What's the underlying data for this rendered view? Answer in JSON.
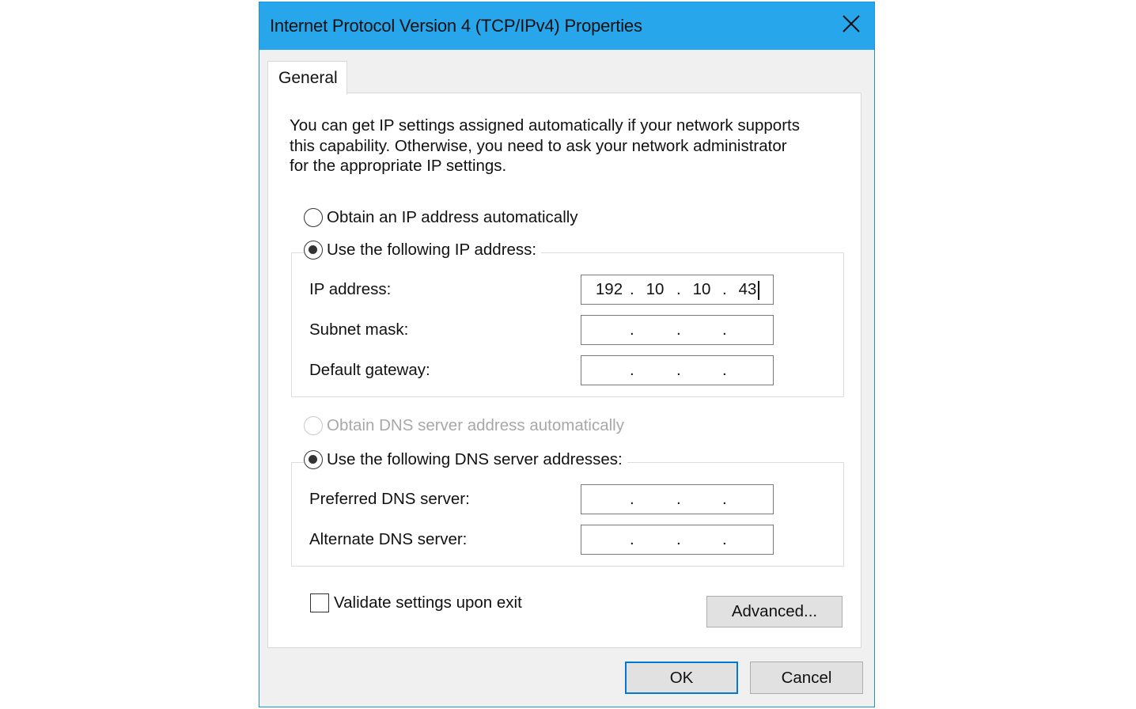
{
  "window": {
    "title": "Internet Protocol Version 4 (TCP/IPv4) Properties"
  },
  "tabs": [
    {
      "label": "General",
      "active": true
    }
  ],
  "description_lines": [
    "You can get IP settings assigned automatically if your network supports",
    "this capability. Otherwise, you need to ask your network administrator",
    "for the appropriate IP settings."
  ],
  "ip_mode": {
    "auto_label": "Obtain an IP address automatically",
    "manual_label": "Use the following IP address:",
    "selected": "manual"
  },
  "ip_fields": {
    "ip_address": {
      "label": "IP address:",
      "octets": [
        "192",
        "10",
        "10",
        "43"
      ]
    },
    "subnet_mask": {
      "label": "Subnet mask:",
      "octets": [
        "",
        "",
        "",
        ""
      ]
    },
    "default_gateway": {
      "label": "Default gateway:",
      "octets": [
        "",
        "",
        "",
        ""
      ]
    }
  },
  "dns_mode": {
    "auto_label": "Obtain DNS server address automatically",
    "auto_disabled": true,
    "manual_label": "Use the following DNS server addresses:",
    "selected": "manual"
  },
  "dns_fields": {
    "preferred": {
      "label": "Preferred DNS server:",
      "octets": [
        "",
        "",
        "",
        ""
      ]
    },
    "alternate": {
      "label": "Alternate DNS server:",
      "octets": [
        "",
        "",
        "",
        ""
      ]
    }
  },
  "validate": {
    "label": "Validate settings upon exit",
    "checked": false
  },
  "buttons": {
    "advanced": "Advanced...",
    "ok": "OK",
    "cancel": "Cancel"
  },
  "colors": {
    "titlebar": "#27a6ec",
    "default_button_border": "#0078d7"
  },
  "icons": {
    "close": "close-icon"
  }
}
